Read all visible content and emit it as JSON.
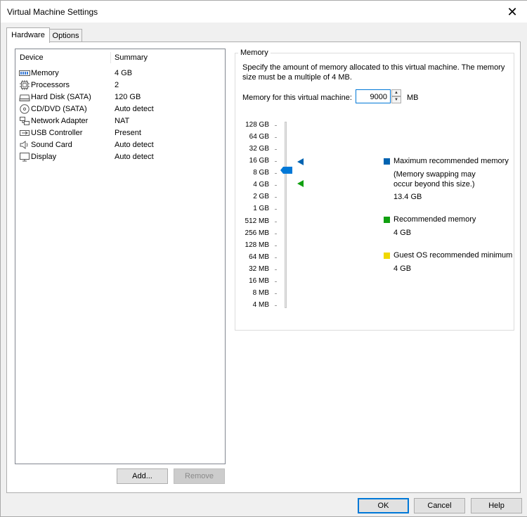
{
  "window": {
    "title": "Virtual Machine Settings",
    "close_glyph": "✕"
  },
  "tabs": [
    {
      "label": "Hardware"
    },
    {
      "label": "Options"
    }
  ],
  "device_list": {
    "col_device": "Device",
    "col_summary": "Summary",
    "devices": [
      {
        "name": "Memory",
        "summary": "4 GB",
        "icon": "memory-icon"
      },
      {
        "name": "Processors",
        "summary": "2",
        "icon": "processor-icon"
      },
      {
        "name": "Hard Disk (SATA)",
        "summary": "120 GB",
        "icon": "hard-disk-icon"
      },
      {
        "name": "CD/DVD (SATA)",
        "summary": "Auto detect",
        "icon": "cd-dvd-icon"
      },
      {
        "name": "Network Adapter",
        "summary": "NAT",
        "icon": "network-adapter-icon"
      },
      {
        "name": "USB Controller",
        "summary": "Present",
        "icon": "usb-icon"
      },
      {
        "name": "Sound Card",
        "summary": "Auto detect",
        "icon": "speaker-icon"
      },
      {
        "name": "Display",
        "summary": "Auto detect",
        "icon": "monitor-icon"
      }
    ]
  },
  "list_buttons": {
    "add": "Add...",
    "remove": "Remove"
  },
  "memory": {
    "group_title": "Memory",
    "description": "Specify the amount of memory allocated to this virtual machine. The memory size must be a multiple of 4 MB.",
    "field_label": "Memory for this virtual machine:",
    "field_value": "9000",
    "unit": "MB",
    "scale": [
      "128 GB",
      "64 GB",
      "32 GB",
      "16 GB",
      "8 GB",
      "4 GB",
      "2 GB",
      "1 GB",
      "512 MB",
      "256 MB",
      "128 MB",
      "64 MB",
      "32 MB",
      "16 MB",
      "8 MB",
      "4 MB"
    ],
    "legend": {
      "max_label": "Maximum recommended memory",
      "max_note": "(Memory swapping may occur beyond this size.)",
      "max_value": "13.4 GB",
      "rec_label": "Recommended memory",
      "rec_value": "4 GB",
      "guest_label": "Guest OS recommended minimum",
      "guest_value": "4 GB"
    },
    "colors": {
      "max": "#0063b1",
      "recommended": "#10a010",
      "guest_min": "#f0d800"
    }
  },
  "footer": {
    "ok": "OK",
    "cancel": "Cancel",
    "help": "Help"
  }
}
